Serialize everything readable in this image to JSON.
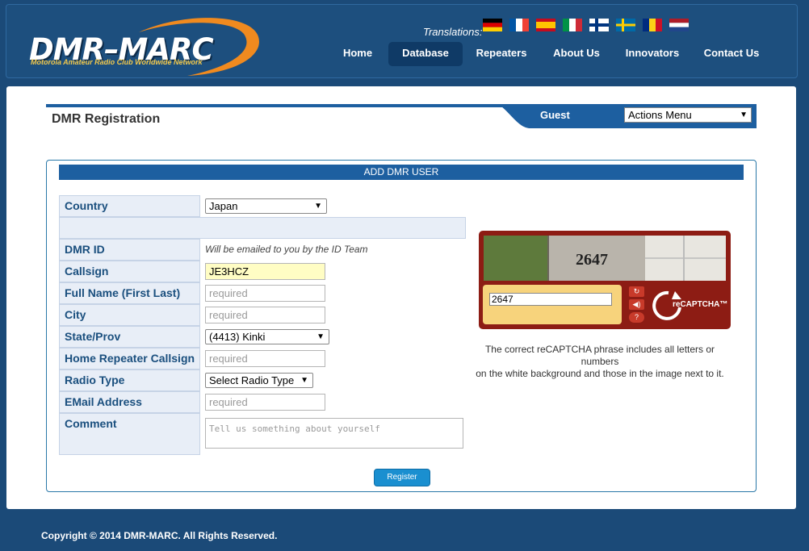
{
  "header": {
    "logo_text": "DMR–MARC",
    "logo_subtitle": "Motorola Amateur Radio Club Worldwide Network",
    "translations_label": "Translations:",
    "flags": [
      "german-flag-icon",
      "french-flag-icon",
      "spanish-flag-icon",
      "italian-flag-icon",
      "finnish-flag-icon",
      "swedish-flag-icon",
      "romanian-flag-icon",
      "dutch-flag-icon"
    ],
    "nav": [
      {
        "label": "Home"
      },
      {
        "label": "Database",
        "active": true
      },
      {
        "label": "Repeaters"
      },
      {
        "label": "About Us"
      },
      {
        "label": "Innovators"
      },
      {
        "label": "Contact Us"
      }
    ]
  },
  "titlebar": {
    "title": "DMR Registration",
    "guest": "Guest",
    "actions_menu": "Actions Menu"
  },
  "form": {
    "heading": "ADD DMR USER",
    "country": {
      "label": "Country",
      "value": "Japan"
    },
    "dmr_id": {
      "label": "DMR ID",
      "note": "Will be emailed to you by the ID Team"
    },
    "callsign": {
      "label": "Callsign",
      "value": "JE3HCZ"
    },
    "full_name": {
      "label": "Full Name (First Last)",
      "placeholder": "required"
    },
    "city": {
      "label": "City",
      "placeholder": "required"
    },
    "state": {
      "label": "State/Prov",
      "value": "(4413) Kinki"
    },
    "home_repeater": {
      "label": "Home Repeater Callsign",
      "placeholder": "required"
    },
    "radio_type": {
      "label": "Radio Type",
      "value": "Select Radio Type"
    },
    "email": {
      "label": "EMail Address",
      "placeholder": "required"
    },
    "comment": {
      "label": "Comment",
      "placeholder": "Tell us something about yourself"
    },
    "register_label": "Register"
  },
  "captcha": {
    "image_text": "2647",
    "input_value": "2647",
    "brand": "reCAPTCHA™",
    "hint_line1": "The correct reCAPTCHA phrase includes all letters or numbers",
    "hint_line2": "on the white background and those in the image next to it."
  },
  "footer": {
    "copyright": "Copyright © 2014 DMR-MARC. All Rights Reserved."
  },
  "colors": {
    "page_bg": "#1b4a78",
    "nav_active": "#0f3a66",
    "panel_head": "#1d5fa0",
    "captcha_bg": "#8d1c14",
    "callsign_bg": "#fffdc4"
  }
}
